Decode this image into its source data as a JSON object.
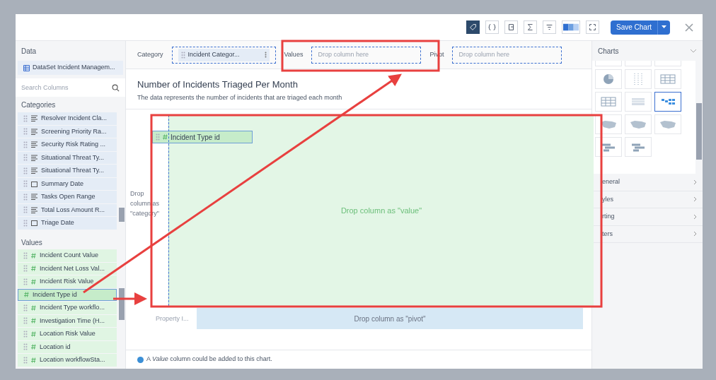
{
  "toolbar": {
    "buttons": [
      {
        "kind": "tag",
        "selected": true
      },
      {
        "kind": "braces",
        "selected": false
      },
      {
        "kind": "export",
        "selected": false
      },
      {
        "kind": "sum",
        "selected": false
      },
      {
        "kind": "filter",
        "selected": false
      },
      {
        "kind": "palette",
        "selected": false
      },
      {
        "kind": "expand",
        "selected": false
      }
    ],
    "save_button": "Save Chart"
  },
  "data_panel": {
    "header": "Data",
    "dataset": "DataSet Incident Managem...",
    "search": {
      "placeholder": "Search Columns"
    },
    "categories_header": "Categories",
    "categories": [
      {
        "label": "Resolver Incident Cla...",
        "kind": "text"
      },
      {
        "label": "Screening Priority Ra...",
        "kind": "text"
      },
      {
        "label": "Security Risk Rating ...",
        "kind": "text"
      },
      {
        "label": "Situational Threat Ty...",
        "kind": "text"
      },
      {
        "label": "Situational Threat Ty...",
        "kind": "text"
      },
      {
        "label": "Summary Date",
        "kind": "date"
      },
      {
        "label": "Tasks Open Range",
        "kind": "text"
      },
      {
        "label": "Total Loss Amount R...",
        "kind": "text"
      },
      {
        "label": "Triage Date",
        "kind": "date"
      }
    ],
    "values_header": "Values",
    "values": [
      {
        "label": "Incident Count Value",
        "selected": false
      },
      {
        "label": "Incident Net Loss Val...",
        "selected": false
      },
      {
        "label": "Incident Risk Value",
        "selected": false
      },
      {
        "label": "Incident Type id",
        "selected": true
      },
      {
        "label": "Incident Type workflo...",
        "selected": false
      },
      {
        "label": "Investigation Time (H...",
        "selected": false
      },
      {
        "label": "Location Risk Value",
        "selected": false
      },
      {
        "label": "Location id",
        "selected": false
      },
      {
        "label": "Location workflowSta...",
        "selected": false
      }
    ]
  },
  "drop_bar": [
    {
      "label": "Category",
      "chip": "Incident Categor..."
    },
    {
      "label": "Values",
      "placeholder": "Drop column here"
    },
    {
      "label": "Pivot",
      "placeholder": "Drop column here"
    }
  ],
  "chart": {
    "title": "Number of Incidents Triaged Per Month",
    "subtitle": "The data represents the number of incidents that are triaged each month",
    "dragged_chip": "Incident Type id",
    "category_drop": "Drop column as \"category\"",
    "value_drop": "Drop column as \"value\"",
    "pivot_drop": "Drop column as \"pivot\"",
    "axis_label": "Property I..."
  },
  "footer": "A *Value* column could be added to this chart.",
  "charts_panel": {
    "header": "Charts",
    "chart_types": [
      {
        "kind": "dots",
        "selected": false
      },
      {
        "kind": "dots",
        "selected": false
      },
      {
        "kind": "dots",
        "selected": false
      },
      {
        "kind": "pie",
        "selected": false
      },
      {
        "kind": "scatter",
        "selected": false
      },
      {
        "kind": "table",
        "selected": false
      },
      {
        "kind": "table",
        "selected": false
      },
      {
        "kind": "pivot",
        "selected": false
      },
      {
        "kind": "heatmap",
        "selected": true
      },
      {
        "kind": "map",
        "selected": false
      },
      {
        "kind": "map",
        "selected": false
      },
      {
        "kind": "map",
        "selected": false
      },
      {
        "kind": "gantt",
        "selected": false
      },
      {
        "kind": "gantt",
        "selected": false
      }
    ],
    "sections": [
      "eneral",
      "yles",
      "rting",
      "ters"
    ]
  }
}
